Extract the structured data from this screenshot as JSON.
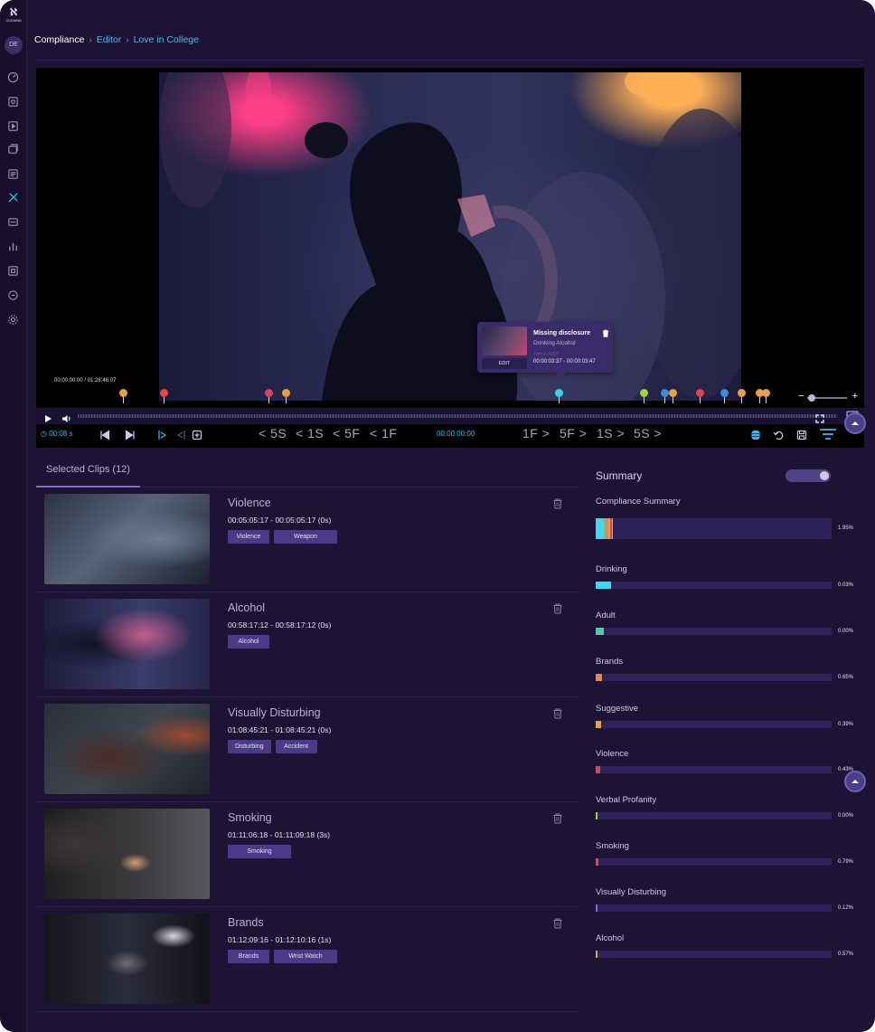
{
  "app": {
    "logo_text": "CLEARAI",
    "user_initials": "DE"
  },
  "breadcrumb": {
    "section": "Compliance",
    "editor": "Editor",
    "title": "Love in College"
  },
  "player": {
    "timecode": "00:00:00:00 / 01:28:46:07",
    "tooltip": {
      "title": "Missing disclosure",
      "subtitle": "Drinking Alcohol",
      "hint": "Trim in /OUT",
      "time": "00:00:03:37 - 00:00:03:47",
      "edit_label": "EDIT"
    },
    "markers": [
      "#e8a045",
      "#e8473f",
      "#d84455",
      "#e8a045",
      "#3fd0e6",
      "#a3d43f",
      "#3c8ad8",
      "#e8a045",
      "#d84455",
      "#3c8ad8",
      "#e8a045",
      "#e8a045",
      "#e8a045"
    ]
  },
  "controls": {
    "current_time": "00:08 s",
    "center_time": "00:00:00:00",
    "back_5s": "< 5S",
    "back_1s": "< 1S",
    "back_5f": "< 5F",
    "back_1f": "< 1F",
    "fwd_1f": "1F >",
    "fwd_5f": "5F >",
    "fwd_1s": "1S >",
    "fwd_5s": "5S >"
  },
  "clips_tab": "Selected Clips (12)",
  "clips": [
    {
      "title": "Violence",
      "time": "00:05:05:17 - 00:05:05:17 (0s)",
      "tags": [
        "Violence",
        "Weapon"
      ]
    },
    {
      "title": "Alcohol",
      "time": "00:58:17:12 - 00:58:17:12 (0s)",
      "tags": [
        "Alcohol"
      ]
    },
    {
      "title": "Visually Disturbing",
      "time": "01:08:45:21 - 01:08:45:21 (0s)",
      "tags": [
        "Disturbing",
        "Accident"
      ]
    },
    {
      "title": "Smoking",
      "time": "01:11:06:18 - 01:11:09:18 (3s)",
      "tags": [
        "Smoking"
      ]
    },
    {
      "title": "Brands",
      "time": "01:12:09:16 - 01:12:10:16 (1s)",
      "tags": [
        "Brands",
        "Wrist Watch"
      ]
    }
  ],
  "summary": {
    "title": "Summary",
    "compliance_label": "Compliance Summary",
    "compliance_pct": "1.95%",
    "compliance_segments": [
      {
        "color": "#3fd8ef",
        "share": 0.035
      },
      {
        "color": "#55c9a4",
        "share": 0.006
      },
      {
        "color": "#e28a52",
        "share": 0.012
      },
      {
        "color": "#e8a045",
        "share": 0.01
      },
      {
        "color": "#d84455",
        "share": 0.006
      },
      {
        "color": "#e8a045",
        "share": 0.005
      }
    ],
    "categories": [
      {
        "label": "Drinking",
        "pct": "0.03%",
        "fill": 0.065,
        "color": "#3fd8ef"
      },
      {
        "label": "Adult",
        "pct": "0.00%",
        "fill": 0.035,
        "color": "#55c9a4"
      },
      {
        "label": "Brands",
        "pct": "0.65%",
        "fill": 0.028,
        "color": "#e28a52"
      },
      {
        "label": "Suggestive",
        "pct": "0.39%",
        "fill": 0.022,
        "color": "#e8a045"
      },
      {
        "label": "Violence",
        "pct": "0.43%",
        "fill": 0.018,
        "color": "#d84455"
      },
      {
        "label": "Verbal Profanity",
        "pct": "0.00%",
        "fill": 0.008,
        "color": "#a3d43f"
      },
      {
        "label": "Smoking",
        "pct": "0.79%",
        "fill": 0.012,
        "color": "#e8473f"
      },
      {
        "label": "Visually Disturbing",
        "pct": "0.12%",
        "fill": 0.006,
        "color": "#7c6fcf"
      },
      {
        "label": "Alcohol",
        "pct": "0.57%",
        "fill": 0.006,
        "color": "#e8a045"
      }
    ]
  }
}
